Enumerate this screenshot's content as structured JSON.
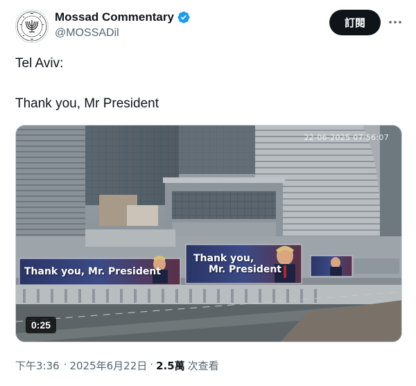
{
  "account": {
    "display_name": "Mossad Commentary",
    "handle": "@MOSSADil",
    "avatar_text": "מוסד לתפקידים מיוחדים",
    "verified": true,
    "verified_color": "#1d9bf0"
  },
  "actions": {
    "follow_label": "訂閱",
    "more_icon": "more-horizontal-icon"
  },
  "tweet": {
    "line1": "Tel Aviv:",
    "line2": "Thank you, Mr President"
  },
  "media": {
    "overlay_timestamp": "22-06-2025 07:56:07",
    "duration": "0:25",
    "billboard_left": "Thank you, Mr. President",
    "billboard_center_1": "Thank you,",
    "billboard_center_2": "Mr. President"
  },
  "meta": {
    "time": "下午3:36",
    "date": "2025年6月22日",
    "separator": "·",
    "views_count": "2.5萬",
    "views_label": "次查看"
  }
}
